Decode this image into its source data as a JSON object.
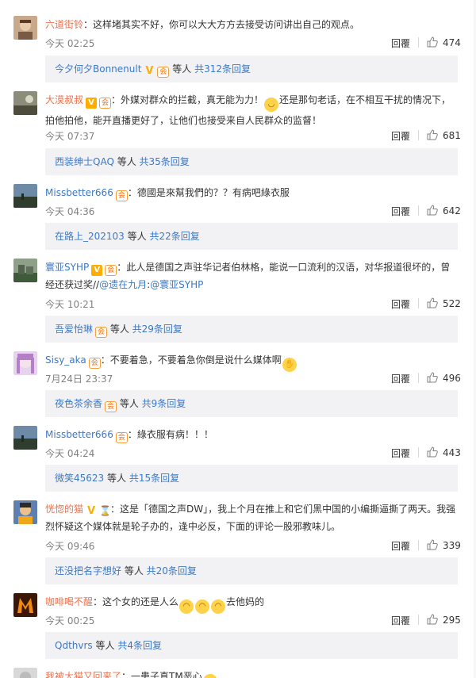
{
  "comments": [
    {
      "user": "六道街铃",
      "badges": [],
      "text": "：这样堵其实不好，你可以大大方方去接受访问讲出自己的观点。",
      "time": "今天 02:25",
      "reply_label": "回覆",
      "likes": "474",
      "replies": {
        "name": "今夕何夕Bonnenult",
        "badges": [
          "v-o",
          "vip"
        ],
        "mid": " 等人 ",
        "count": "共312条回复"
      }
    },
    {
      "user": "大漠叔叔",
      "badges": [
        "v",
        "vip"
      ],
      "text_a": "：外媒对群众的拦截，真无能为力！",
      "text_b": "还是那句老话，在不相互干扰的情况下，拍他拍他，能开直播更好了，让他们也接受来自人民群众的监督！",
      "time": "今天 07:37",
      "reply_label": "回覆",
      "likes": "681",
      "replies": {
        "name": "西装绅士QAQ",
        "badges": [],
        "mid": " 等人 ",
        "count": "共35条回复"
      }
    },
    {
      "user": "Missbetter666",
      "badges": [
        "vip"
      ],
      "text": "：德國是來幫我們的？？有病吧綠衣服",
      "time": "今天 04:36",
      "reply_label": "回覆",
      "likes": "642",
      "replies": {
        "name": "在路上_202103",
        "badges": [],
        "mid": " 等人 ",
        "count": "共22条回复"
      }
    },
    {
      "user": "寰亚SYHP",
      "badges": [
        "v",
        "vip"
      ],
      "text": "：此人是德国之声驻华记者伯林格，能说一口流利的汉语，对华报道很坏的，曾经还获过奖//",
      "mention1": "@遗在九月",
      "mention_sep": ":",
      "mention2": "@寰亚SYHP",
      "time": "今天 10:21",
      "reply_label": "回覆",
      "likes": "522",
      "replies": {
        "name": "吾爱怡琳",
        "badges": [
          "vip"
        ],
        "mid": " 等人 ",
        "count": "共29条回复"
      }
    },
    {
      "user": "Sisy_aka",
      "badges": [
        "vip"
      ],
      "text": "：不要着急，不要着急你倒是说什么媒体啊",
      "time": "7月24日 23:37",
      "reply_label": "回覆",
      "likes": "496",
      "replies": {
        "name": "夜色茶余香",
        "badges": [
          "vip"
        ],
        "mid": " 等人 ",
        "count": "共9条回复"
      }
    },
    {
      "user": "Missbetter666",
      "badges": [
        "vip"
      ],
      "text": "：綠衣服有病！！！",
      "time": "今天 04:24",
      "reply_label": "回覆",
      "likes": "443",
      "replies": {
        "name": "微笑45623",
        "badges": [],
        "mid": " 等人 ",
        "count": "共15条回复"
      }
    },
    {
      "user": "恍惚的猫",
      "badges": [
        "v-o",
        "hour"
      ],
      "text": "：这是「德国之声DW」，我上个月在推上和它们黑中国的小编撕逼撕了两天。我强烈怀疑这个媒体就是轮子办的，逢中必反，下面的评论一股邪教味儿。",
      "time": "今天 09:46",
      "reply_label": "回覆",
      "likes": "339",
      "replies": {
        "name": "还没把名字想好",
        "badges": [],
        "mid": " 等人 ",
        "count": "共20条回复"
      }
    },
    {
      "user": "咖啡喝不醒",
      "badges": [],
      "text_a": "：这个女的还是人么",
      "text_b": "去他妈的",
      "time": "今天 00:25",
      "reply_label": "回覆",
      "likes": "295",
      "replies": {
        "name": "Qdthvrs",
        "badges": [],
        "mid": " 等人 ",
        "count": "共4条回复"
      }
    },
    {
      "user": "我被大猫又回来了",
      "badges": [],
      "text": "：一患子真TM恶心"
    }
  ],
  "colors": {
    "name": "#eb7350",
    "link": "#3b79c8",
    "meta": "#808080",
    "reply_bg": "#f2f2f5"
  }
}
